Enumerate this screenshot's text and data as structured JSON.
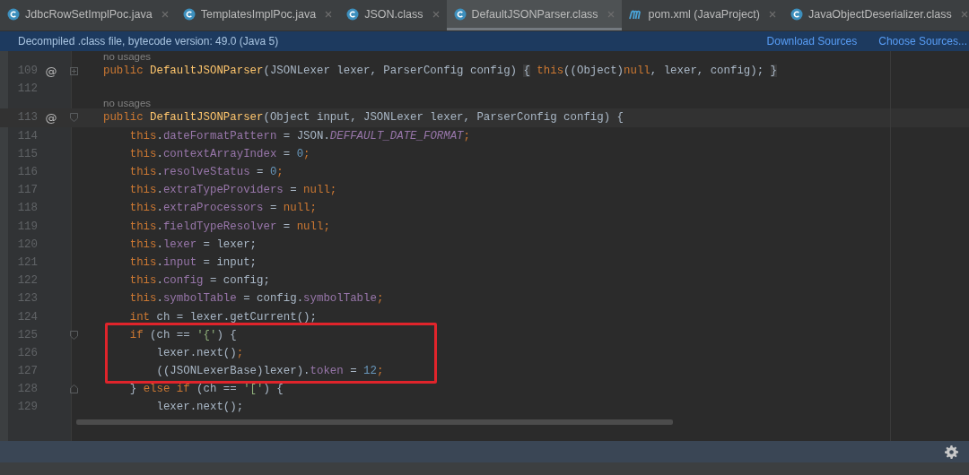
{
  "tabs": [
    {
      "label": "JdbcRowSetImplPoc.java",
      "kind": "class",
      "selected": false
    },
    {
      "label": "TemplatesImplPoc.java",
      "kind": "class",
      "selected": false
    },
    {
      "label": "JSON.class",
      "kind": "class",
      "selected": false
    },
    {
      "label": "DefaultJSONParser.class",
      "kind": "class",
      "selected": true
    },
    {
      "label": "pom.xml (JavaProject)",
      "kind": "maven",
      "selected": false
    },
    {
      "label": "JavaObjectDeserializer.class",
      "kind": "class",
      "selected": false
    }
  ],
  "banner": {
    "message": "Decompiled .class file, bytecode version: 49.0 (Java 5)",
    "links": [
      "Download Sources",
      "Choose Sources..."
    ]
  },
  "editor": {
    "lines": [
      {
        "kind": "hint",
        "text": "no usages"
      },
      {
        "kind": "code",
        "number": "109",
        "annotation": "@",
        "folded": true,
        "current": false,
        "boxed": false,
        "tokens": [
          {
            "kind": "kw",
            "text": "public "
          },
          {
            "kind": "decl",
            "text": "DefaultJSONParser"
          },
          {
            "kind": "plain",
            "text": "(JSONLexer lexer, ParserConfig config) "
          },
          {
            "kind": "fold",
            "text": "{"
          },
          {
            "kind": "kw",
            "text": " this"
          },
          {
            "kind": "plain",
            "text": "((Object)"
          },
          {
            "kind": "kw",
            "text": "null"
          },
          {
            "kind": "plain",
            "text": ", lexer, config); "
          },
          {
            "kind": "fold",
            "text": "}"
          }
        ]
      },
      {
        "kind": "code",
        "number": "112",
        "current": false,
        "boxed": false
      },
      {
        "kind": "hint",
        "text": "no usages"
      },
      {
        "kind": "code",
        "number": "113",
        "annotation": "@",
        "folded": false,
        "current": true,
        "boxed": false,
        "tokens": [
          {
            "kind": "kw",
            "text": "public "
          },
          {
            "kind": "decl",
            "text": "DefaultJSONParser"
          },
          {
            "kind": "plain",
            "text": "(Object input, JSONLexer lexer, ParserConfig config) {"
          }
        ]
      },
      {
        "kind": "code",
        "number": "114",
        "current": false,
        "boxed": false,
        "tokens": [
          {
            "kind": "kw",
            "text": "    this"
          },
          {
            "kind": "plain",
            "text": "."
          },
          {
            "kind": "field",
            "text": "dateFormatPattern"
          },
          {
            "kind": "plain",
            "text": " = JSON."
          },
          {
            "kind": "const",
            "text": "DEFFAULT_DATE_FORMAT"
          },
          {
            "kind": "kw",
            "text": ";"
          }
        ]
      },
      {
        "kind": "code",
        "number": "115",
        "current": false,
        "boxed": false,
        "tokens": [
          {
            "kind": "kw",
            "text": "    this"
          },
          {
            "kind": "plain",
            "text": "."
          },
          {
            "kind": "field",
            "text": "contextArrayIndex"
          },
          {
            "kind": "plain",
            "text": " = "
          },
          {
            "kind": "num",
            "text": "0"
          },
          {
            "kind": "kw",
            "text": ";"
          }
        ]
      },
      {
        "kind": "code",
        "number": "116",
        "current": false,
        "boxed": false,
        "tokens": [
          {
            "kind": "kw",
            "text": "    this"
          },
          {
            "kind": "plain",
            "text": "."
          },
          {
            "kind": "field",
            "text": "resolveStatus"
          },
          {
            "kind": "plain",
            "text": " = "
          },
          {
            "kind": "num",
            "text": "0"
          },
          {
            "kind": "kw",
            "text": ";"
          }
        ]
      },
      {
        "kind": "code",
        "number": "117",
        "current": false,
        "boxed": false,
        "tokens": [
          {
            "kind": "kw",
            "text": "    this"
          },
          {
            "kind": "plain",
            "text": "."
          },
          {
            "kind": "field",
            "text": "extraTypeProviders"
          },
          {
            "kind": "plain",
            "text": " = "
          },
          {
            "kind": "kw",
            "text": "null;"
          }
        ]
      },
      {
        "kind": "code",
        "number": "118",
        "current": false,
        "boxed": false,
        "tokens": [
          {
            "kind": "kw",
            "text": "    this"
          },
          {
            "kind": "plain",
            "text": "."
          },
          {
            "kind": "field",
            "text": "extraProcessors"
          },
          {
            "kind": "plain",
            "text": " = "
          },
          {
            "kind": "kw",
            "text": "null;"
          }
        ]
      },
      {
        "kind": "code",
        "number": "119",
        "current": false,
        "boxed": false,
        "tokens": [
          {
            "kind": "kw",
            "text": "    this"
          },
          {
            "kind": "plain",
            "text": "."
          },
          {
            "kind": "field",
            "text": "fieldTypeResolver"
          },
          {
            "kind": "plain",
            "text": " = "
          },
          {
            "kind": "kw",
            "text": "null;"
          }
        ]
      },
      {
        "kind": "code",
        "number": "120",
        "current": false,
        "boxed": false,
        "tokens": [
          {
            "kind": "kw",
            "text": "    this"
          },
          {
            "kind": "plain",
            "text": "."
          },
          {
            "kind": "field",
            "text": "lexer"
          },
          {
            "kind": "plain",
            "text": " = lexer;"
          }
        ]
      },
      {
        "kind": "code",
        "number": "121",
        "current": false,
        "boxed": false,
        "tokens": [
          {
            "kind": "kw",
            "text": "    this"
          },
          {
            "kind": "plain",
            "text": "."
          },
          {
            "kind": "field",
            "text": "input"
          },
          {
            "kind": "plain",
            "text": " = input;"
          }
        ]
      },
      {
        "kind": "code",
        "number": "122",
        "current": false,
        "boxed": false,
        "tokens": [
          {
            "kind": "kw",
            "text": "    this"
          },
          {
            "kind": "plain",
            "text": "."
          },
          {
            "kind": "field",
            "text": "config"
          },
          {
            "kind": "plain",
            "text": " = config;"
          }
        ]
      },
      {
        "kind": "code",
        "number": "123",
        "current": false,
        "boxed": false,
        "tokens": [
          {
            "kind": "kw",
            "text": "    this"
          },
          {
            "kind": "plain",
            "text": "."
          },
          {
            "kind": "field",
            "text": "symbolTable"
          },
          {
            "kind": "plain",
            "text": " = config."
          },
          {
            "kind": "field",
            "text": "symbolTable"
          },
          {
            "kind": "kw",
            "text": ";"
          }
        ]
      },
      {
        "kind": "code",
        "number": "124",
        "current": false,
        "boxed": false,
        "tokens": [
          {
            "kind": "kw",
            "text": "    int"
          },
          {
            "kind": "plain",
            "text": " ch = lexer.getCurrent();"
          }
        ]
      },
      {
        "kind": "code",
        "number": "125",
        "folded": false,
        "current": false,
        "boxed": true,
        "tokens": [
          {
            "kind": "kw",
            "text": "    if"
          },
          {
            "kind": "plain",
            "text": " (ch == "
          },
          {
            "kind": "str",
            "text": "'{'"
          },
          {
            "kind": "plain",
            "text": ") {"
          }
        ]
      },
      {
        "kind": "code",
        "number": "126",
        "current": false,
        "boxed": true,
        "tokens": [
          {
            "kind": "plain",
            "text": "        lexer.next()"
          },
          {
            "kind": "kw",
            "text": ";"
          }
        ]
      },
      {
        "kind": "code",
        "number": "127",
        "current": false,
        "boxed": true,
        "tokens": [
          {
            "kind": "plain",
            "text": "        ((JSONLexerBase)lexer)."
          },
          {
            "kind": "field",
            "text": "token"
          },
          {
            "kind": "plain",
            "text": " = "
          },
          {
            "kind": "num",
            "text": "12"
          },
          {
            "kind": "kw",
            "text": ";"
          }
        ]
      },
      {
        "kind": "code",
        "number": "128",
        "fold_end": true,
        "current": false,
        "boxed": false,
        "tokens": [
          {
            "kind": "plain",
            "text": "    } "
          },
          {
            "kind": "kw",
            "text": "else if"
          },
          {
            "kind": "plain",
            "text": " (ch == "
          },
          {
            "kind": "str",
            "text": "'['"
          },
          {
            "kind": "plain",
            "text": ") {"
          }
        ]
      },
      {
        "kind": "code",
        "number": "129",
        "current": false,
        "boxed": false,
        "tokens": [
          {
            "kind": "plain",
            "text": "        lexer.next();"
          }
        ]
      }
    ]
  }
}
